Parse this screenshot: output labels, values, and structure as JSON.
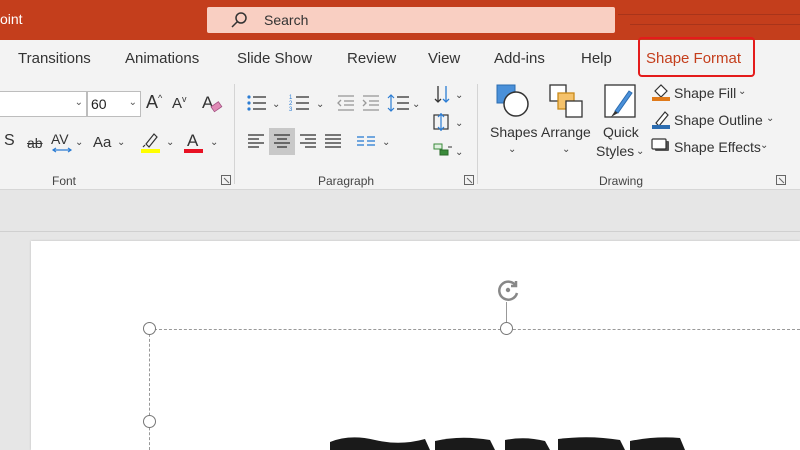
{
  "window": {
    "app_name_fragment": "oint"
  },
  "search": {
    "label": "Search"
  },
  "tabs": [
    {
      "label": "Transitions"
    },
    {
      "label": "Animations"
    },
    {
      "label": "Slide Show"
    },
    {
      "label": "Review"
    },
    {
      "label": "View"
    },
    {
      "label": "Add-ins"
    },
    {
      "label": "Help"
    },
    {
      "label": "Shape Format"
    }
  ],
  "ribbon": {
    "font": {
      "group_label": "Font",
      "font_name_value": "",
      "font_size_value": "60",
      "strike_label": "ab",
      "spacing_label": "AV",
      "case_label": "Aa",
      "bold_fragment": "S"
    },
    "paragraph": {
      "group_label": "Paragraph"
    },
    "drawing": {
      "group_label": "Drawing",
      "shapes_label": "Shapes",
      "arrange_label": "Arrange",
      "quick_styles_label_1": "Quick",
      "quick_styles_label_2": "Styles",
      "shape_fill_label": "Shape Fill",
      "shape_outline_label": "Shape Outline",
      "shape_effects_label": "Shape Effects"
    }
  },
  "colors": {
    "title_bar": "#c43e1c",
    "accent_text": "#c43e1c",
    "highlight_box": "#e41b1b",
    "highlight_yellow": "#ffff00",
    "font_color_red": "#e81123"
  }
}
